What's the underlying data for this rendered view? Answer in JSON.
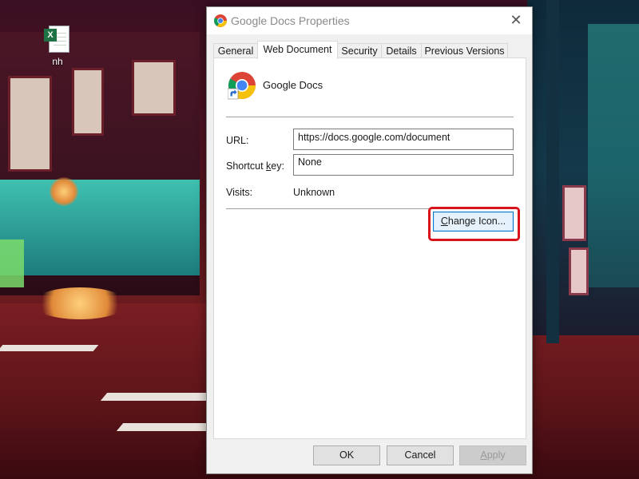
{
  "desktop": {
    "icon_label": "nh",
    "icon_badge": "X"
  },
  "dialog": {
    "title": "Google Docs Properties",
    "close_glyph": "✕",
    "tabs": [
      {
        "label": "General",
        "active": false
      },
      {
        "label": "Web Document",
        "active": true
      },
      {
        "label": "Security",
        "active": false
      },
      {
        "label": "Details",
        "active": false
      },
      {
        "label": "Previous Versions",
        "active": false
      }
    ],
    "app_name": "Google Docs",
    "fields": {
      "url_label": "URL:",
      "url_value": "https://docs.google.com/document",
      "shortcut_label_pre": "Shortcut ",
      "shortcut_label_key": "k",
      "shortcut_label_post": "ey:",
      "shortcut_value": "None",
      "visits_label": "Visits:",
      "visits_value": "Unknown"
    },
    "change_icon_pre": "",
    "change_icon_key": "C",
    "change_icon_post": "hange Icon...",
    "buttons": {
      "ok": "OK",
      "cancel": "Cancel",
      "apply_key": "A",
      "apply_post": "pply"
    }
  },
  "colors": {
    "highlight": "#d8131b",
    "focus_blue": "#0078d7",
    "excel_green": "#1f7244"
  },
  "icons": {
    "app_icon": "chrome-icon",
    "shortcut_overlay": "shortcut-arrow-icon",
    "desktop_file": "excel-file-icon"
  }
}
